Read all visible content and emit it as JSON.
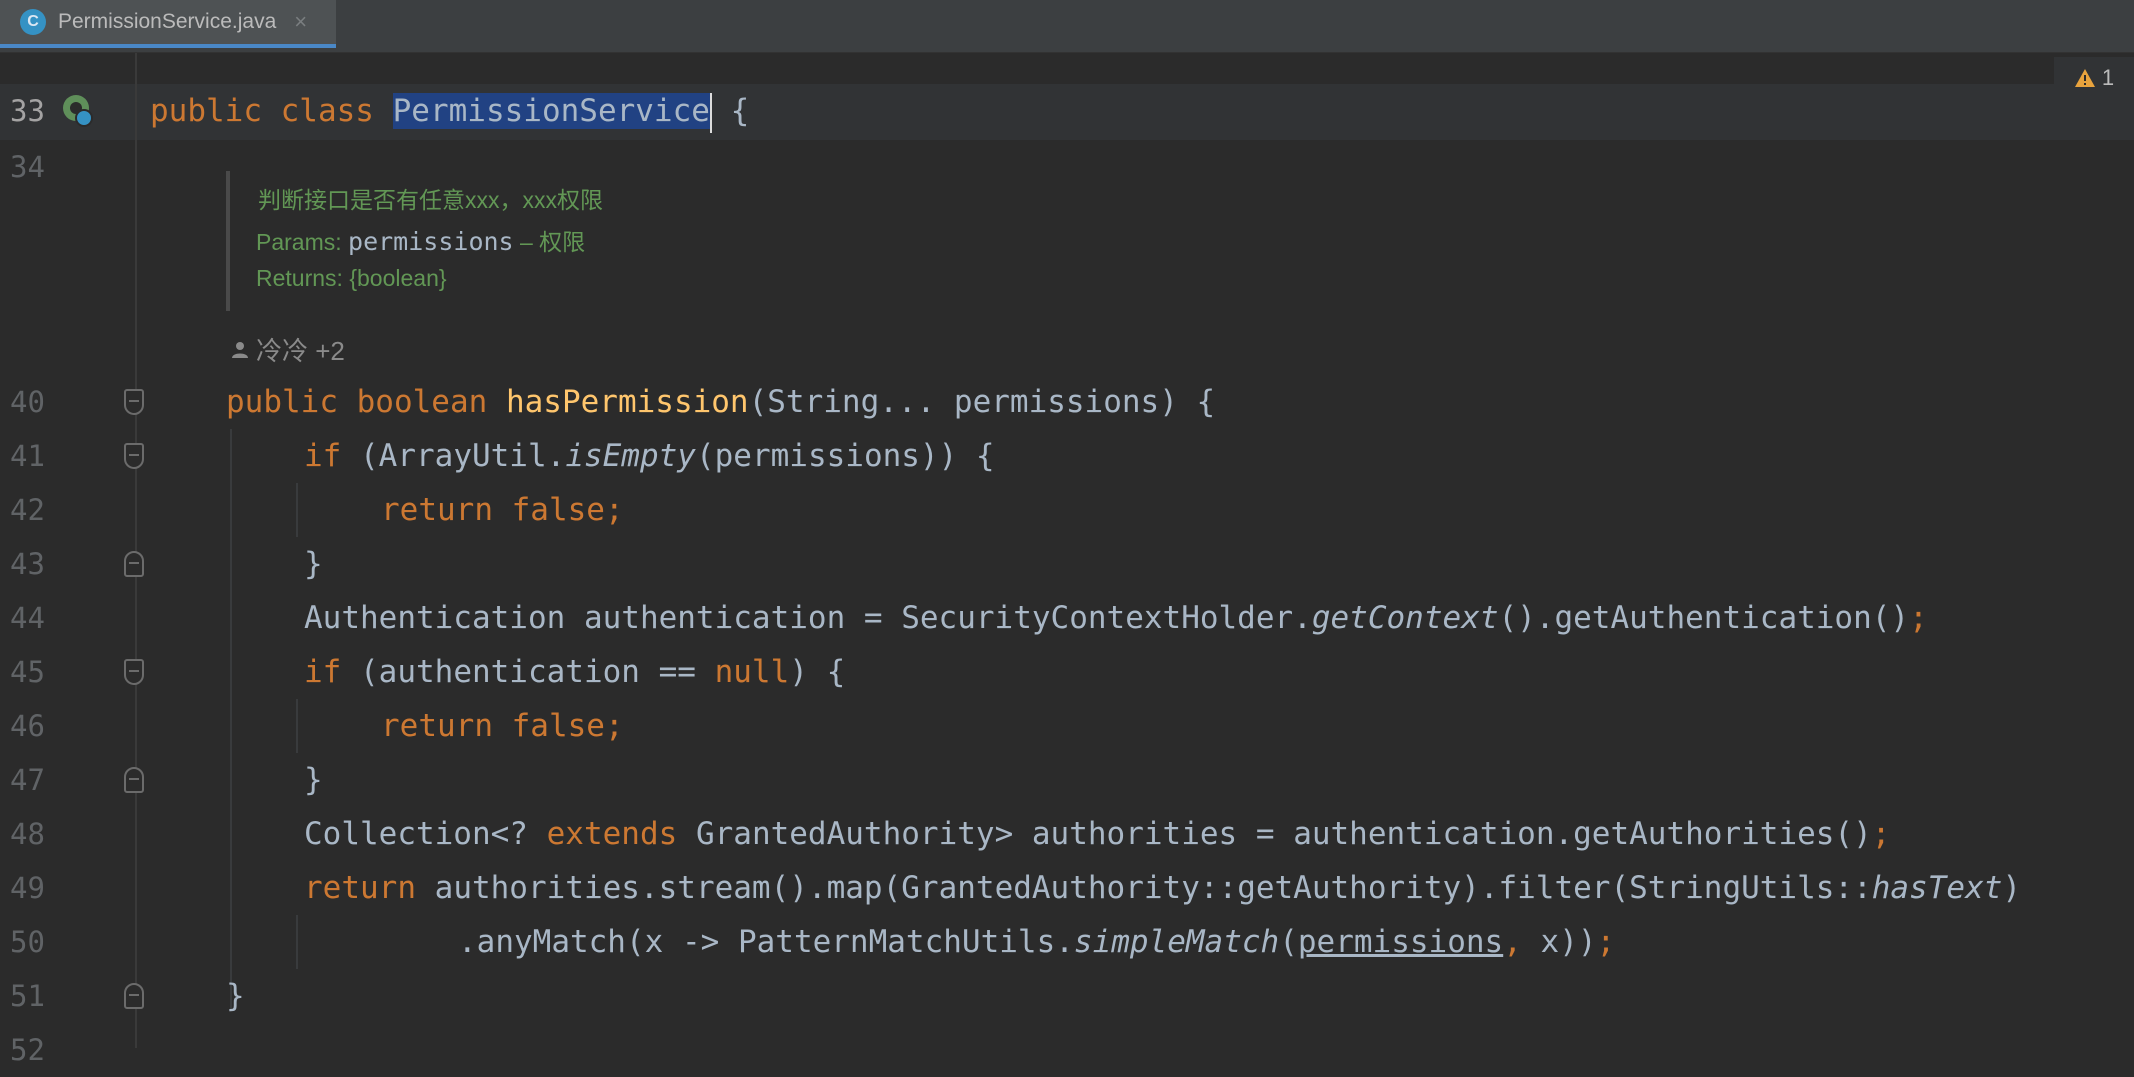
{
  "tab": {
    "icon": "C",
    "title": "PermissionService.java",
    "close": "×"
  },
  "warnings": {
    "count": "1"
  },
  "doc": {
    "summary": "判断接口是否有任意xxx，xxx权限",
    "params_label": "Params:",
    "params_name": "permissions",
    "params_desc": " – 权限",
    "returns": "Returns: {boolean}"
  },
  "author": {
    "text": "冷冷 +2"
  },
  "lines": {
    "n33": "33",
    "n34": "34",
    "n40": "40",
    "n41": "41",
    "n42": "42",
    "n43": "43",
    "n44": "44",
    "n45": "45",
    "n46": "46",
    "n47": "47",
    "n48": "48",
    "n49": "49",
    "n50": "50",
    "n51": "51",
    "n52": "52"
  },
  "code": {
    "l33": {
      "a": "public class ",
      "sel": "PermissionService",
      "b": " {"
    },
    "l40": {
      "kw": "public boolean ",
      "fn": "hasPermission",
      "rest": "(String... permissions) {"
    },
    "l41": {
      "kw": "if ",
      "a": "(ArrayUtil.",
      "it": "isEmpty",
      "b": "(permissions)) {"
    },
    "l42": {
      "kw": "return false;"
    },
    "l43": {
      "a": "}"
    },
    "l44": {
      "a": "Authentication authentication = SecurityContextHolder.",
      "it": "getContext",
      "b": "().getAuthentication()",
      "semi": ";"
    },
    "l45": {
      "kw": "if ",
      "a": "(authentication == ",
      "kw2": "null",
      "b": ") {"
    },
    "l46": {
      "kw": "return false;"
    },
    "l47": {
      "a": "}"
    },
    "l48": {
      "a": "Collection<? ",
      "kw": "extends ",
      "b": "GrantedAuthority> authorities = authentication.getAuthorities()",
      "semi": ";"
    },
    "l49": {
      "kw": "return ",
      "a": "authorities.stream().map(GrantedAuthority::getAuthority).filter(StringUtils::",
      "it": "hasText",
      "b": ")"
    },
    "l50": {
      "a": ".anyMatch(x -> PatternMatchUtils.",
      "it": "simpleMatch",
      "b": "(",
      "ul": "permissions",
      "comma": ",",
      "c": " x))",
      "semi": ";"
    },
    "l51": {
      "a": "}"
    }
  }
}
